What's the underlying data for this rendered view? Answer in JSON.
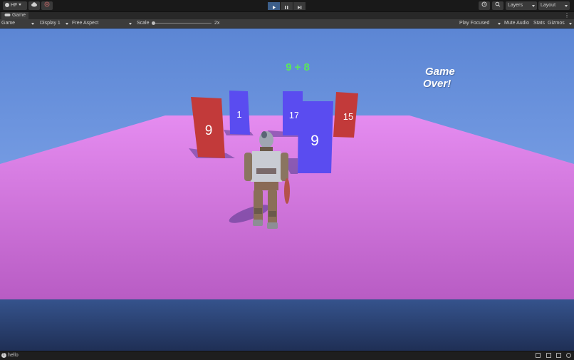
{
  "toolbar": {
    "account_label": "HF",
    "layers_label": "Layers",
    "layout_label": "Layout"
  },
  "tab": {
    "title": "Game"
  },
  "game_bar": {
    "view_select": "Game",
    "display_select": "Display 1",
    "aspect_select": "Free Aspect",
    "scale_label": "Scale",
    "scale_value": "2x",
    "play_mode": "Play Focused",
    "mute_audio": "Mute Audio",
    "stats": "Stats",
    "gizmos": "Gizmos"
  },
  "scene": {
    "equation": "9 + 8",
    "game_over_line1": "Game",
    "game_over_line2": "Over!",
    "panels": [
      {
        "value": "9",
        "color": "#c23a3a"
      },
      {
        "value": "1",
        "color": "#5a4cf0"
      },
      {
        "value": "17",
        "color": "#5a4cf0"
      },
      {
        "value": "15",
        "color": "#c23a3a"
      },
      {
        "value": "9",
        "color": "#5a4cf0"
      }
    ],
    "colors": {
      "sky": "#6e93d8",
      "floor": "#d580e0",
      "water": "#2a3e6a"
    }
  },
  "status": {
    "message": "hello"
  }
}
